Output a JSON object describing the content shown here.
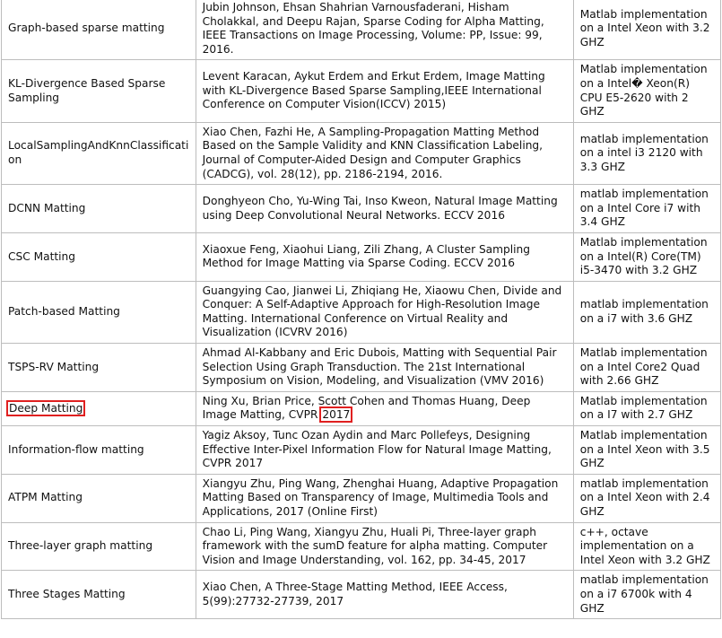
{
  "highlight_color": "#e02020",
  "rows": [
    {
      "method": "Graph-based sparse matting",
      "reference": "Jubin Johnson, Ehsan Shahrian Varnousfaderani, Hisham Cholakkal, and Deepu Rajan, Sparse Coding for Alpha Matting, IEEE Transactions on Image Processing, Volume: PP, Issue: 99, 2016.",
      "implementation": "Matlab implementation on a Intel Xeon with 3.2 GHZ"
    },
    {
      "method": "KL-Divergence Based Sparse Sampling",
      "reference": "Levent Karacan, Aykut Erdem and Erkut Erdem, Image Matting with KL-Divergence Based Sparse Sampling,IEEE International Conference on Computer Vision(ICCV) 2015)",
      "implementation": "Matlab implementation on a Intel� Xeon(R) CPU E5-2620 with 2 GHZ"
    },
    {
      "method": "LocalSamplingAndKnnClassification",
      "reference": "Xiao Chen, Fazhi He, A Sampling-Propagation Matting Method Based on the Sample Validity and KNN Classification Labeling, Journal of Computer-Aided Design and Computer Graphics (CADCG), vol. 28(12), pp. 2186-2194, 2016.",
      "implementation": "matlab implementation on a intel i3 2120 with 3.3 GHZ"
    },
    {
      "method": "DCNN Matting",
      "reference": "Donghyeon Cho, Yu-Wing Tai, Inso Kweon, Natural Image Matting using Deep Convolutional Neural Networks. ECCV 2016",
      "implementation": "matlab implementation on a Intel Core i7 with 3.4 GHZ"
    },
    {
      "method": "CSC Matting",
      "reference": "Xiaoxue Feng, Xiaohui Liang, Zili Zhang, A Cluster Sampling Method for Image Matting via Sparse Coding. ECCV 2016",
      "implementation": "Matlab implementation on a Intel(R) Core(TM) i5-3470 with 3.2 GHZ"
    },
    {
      "method": "Patch-based Matting",
      "reference": "Guangying Cao, Jianwei Li, Zhiqiang He, Xiaowu Chen, Divide and Conquer: A Self-Adaptive Approach for High-Resolution Image Matting. International Conference on Virtual Reality and Visualization (ICVRV 2016)",
      "implementation": "matlab implementation on a i7 with 3.6 GHZ"
    },
    {
      "method": "TSPS-RV Matting",
      "reference": "Ahmad Al-Kabbany and Eric Dubois, Matting with Sequential Pair Selection Using Graph Transduction. The 21st International Symposium on Vision, Modeling, and Visualization (VMV 2016)",
      "implementation": "Matlab implementation on a Intel Core2 Quad with 2.66 GHZ"
    },
    {
      "method": "Deep Matting",
      "method_highlighted": true,
      "reference_pre": "Ning Xu, Brian Price, Scott Cohen and Thomas Huang, Deep Image Matting, CVPR",
      "reference_hl": "2017",
      "implementation": "Matlab implementation on a I7 with 2.7 GHZ"
    },
    {
      "method": "Information-flow matting",
      "reference": "Yagiz Aksoy, Tunc Ozan Aydin and Marc Pollefeys, Designing Effective Inter-Pixel Information Flow for Natural Image Matting, CVPR 2017",
      "implementation": "Matlab implementation on a Intel Xeon with 3.5 GHZ"
    },
    {
      "method": "ATPM Matting",
      "reference": "Xiangyu Zhu, Ping Wang, Zhenghai Huang, Adaptive Propagation Matting Based on Transparency of Image, Multimedia Tools and Applications, 2017 (Online First)",
      "implementation": "matlab implementation on a Intel Xeon with 2.4 GHZ"
    },
    {
      "method": "Three-layer graph matting",
      "reference": "Chao Li, Ping Wang, Xiangyu Zhu, Huali Pi, Three-layer graph framework with the sumD feature for alpha matting. Computer Vision and Image Understanding, vol. 162, pp. 34-45, 2017",
      "implementation": "c++, octave implementation on a Intel Xeon with 3.2 GHZ"
    },
    {
      "method": "Three Stages Matting",
      "reference": "Xiao Chen, A Three-Stage Matting Method, IEEE Access, 5(99):27732-27739, 2017",
      "implementation": "matlab implementation on a i7 6700k with 4 GHZ"
    }
  ]
}
